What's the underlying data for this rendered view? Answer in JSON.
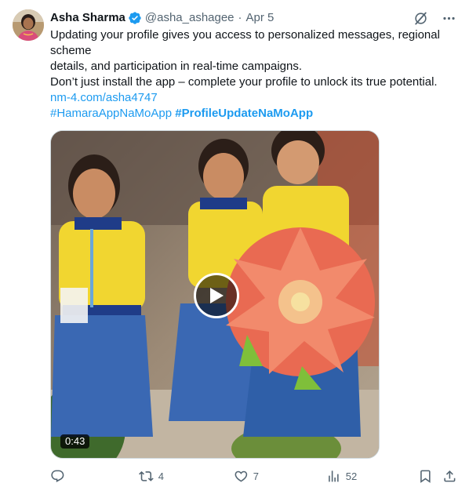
{
  "tweet": {
    "author_name": "Asha Sharma",
    "handle": "@asha_ashagee",
    "separator": "·",
    "date": "Apr 5",
    "text_lines": [
      "Updating your profile gives you access to personalized messages, regional",
      "scheme",
      "details, and participation in real-time campaigns.",
      "Don’t just install the app – complete your profile to unlock its true potential."
    ],
    "link": "nm-4.com/asha4747",
    "hashtag_1": "#HamaraAppNaMoApp",
    "hashtag_2": "#ProfileUpdateNaMoApp"
  },
  "media": {
    "duration": "0:43",
    "type": "video"
  },
  "actions": {
    "reply_count": "",
    "retweet_count": "4",
    "like_count": "7",
    "views_count": "52"
  },
  "icons": {
    "verified": "verified-badge-icon",
    "grok": "grok-icon",
    "more": "more-icon",
    "reply": "reply-icon",
    "retweet": "retweet-icon",
    "like": "heart-icon",
    "views": "views-icon",
    "bookmark": "bookmark-icon",
    "share": "share-icon",
    "play": "play-icon"
  },
  "colors": {
    "accent": "#1d9bf0",
    "text": "#0f1419",
    "muted": "#536471"
  }
}
